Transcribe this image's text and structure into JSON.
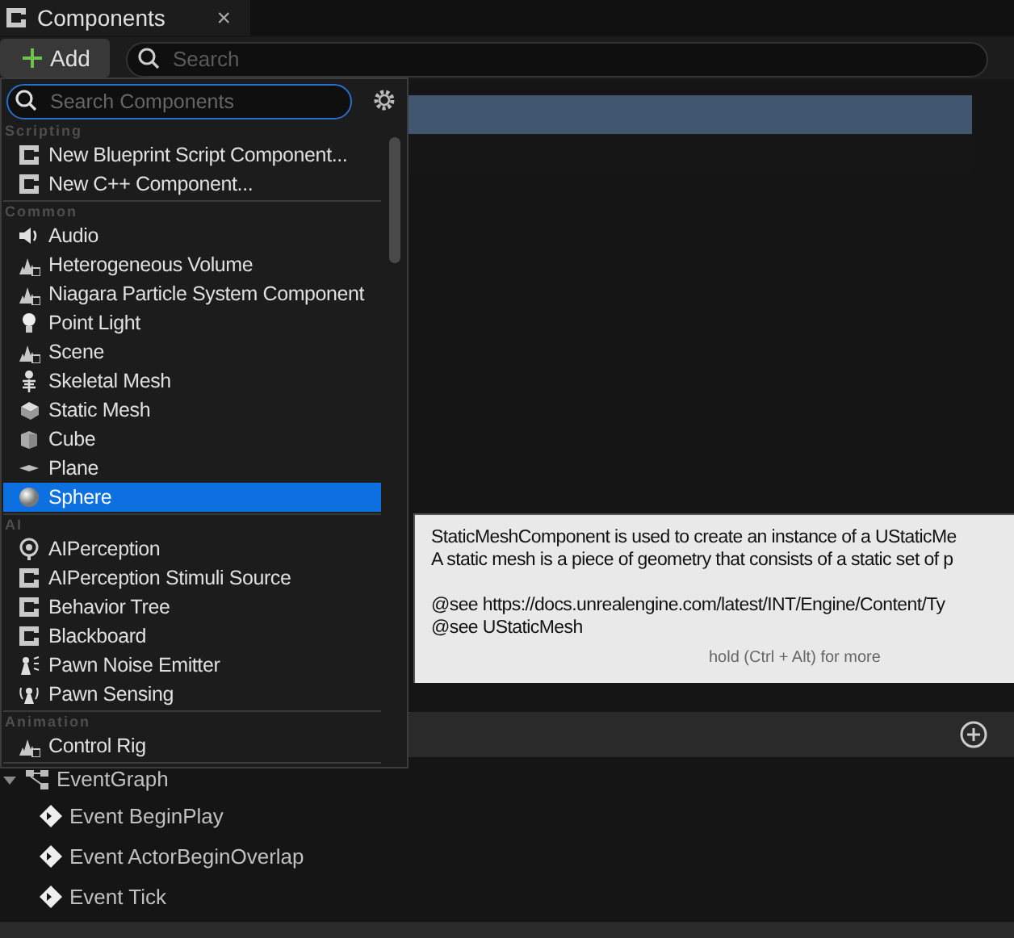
{
  "tab": {
    "title": "Components",
    "close": "×"
  },
  "toolbar": {
    "add_label": "Add",
    "search_placeholder": "Search"
  },
  "popup": {
    "search_placeholder": "Search Components",
    "sections": [
      {
        "title": "Scripting",
        "items": [
          {
            "label": "New Blueprint Script Component...",
            "kind": "class",
            "selected": false
          },
          {
            "label": "New C++ Component...",
            "kind": "class",
            "selected": false
          }
        ]
      },
      {
        "title": "Common",
        "items": [
          {
            "label": "Audio",
            "kind": "audio",
            "selected": false
          },
          {
            "label": "Heterogeneous Volume",
            "kind": "particles",
            "selected": false
          },
          {
            "label": "Niagara Particle System Component",
            "kind": "particles",
            "selected": false
          },
          {
            "label": "Point Light",
            "kind": "light",
            "selected": false
          },
          {
            "label": "Scene",
            "kind": "particles",
            "selected": false
          },
          {
            "label": "Skeletal Mesh",
            "kind": "skeleton",
            "selected": false
          },
          {
            "label": "Static Mesh",
            "kind": "mesh",
            "selected": false
          },
          {
            "label": "Cube",
            "kind": "cube",
            "selected": false
          },
          {
            "label": "Plane",
            "kind": "plane",
            "selected": false
          },
          {
            "label": "Sphere",
            "kind": "sphere",
            "selected": true
          }
        ]
      },
      {
        "title": "AI",
        "items": [
          {
            "label": "AIPerception",
            "kind": "perception",
            "selected": false
          },
          {
            "label": "AIPerception Stimuli Source",
            "kind": "class",
            "selected": false
          },
          {
            "label": "Behavior Tree",
            "kind": "class",
            "selected": false
          },
          {
            "label": "Blackboard",
            "kind": "class",
            "selected": false
          },
          {
            "label": "Pawn Noise Emitter",
            "kind": "pawn-noise",
            "selected": false
          },
          {
            "label": "Pawn Sensing",
            "kind": "pawn-sensing",
            "selected": false
          }
        ]
      },
      {
        "title": "Animation",
        "items": [
          {
            "label": "Control Rig",
            "kind": "particles",
            "selected": false
          }
        ]
      }
    ]
  },
  "tooltip": {
    "paragraphs": [
      [
        "StaticMeshComponent is used to create an instance of a UStaticMe",
        "A static mesh is a piece of geometry that consists of a static set of p"
      ],
      [
        "@see https://docs.unrealengine.com/latest/INT/Engine/Content/Ty",
        "@see UStaticMesh"
      ]
    ],
    "hint": "hold (Ctrl + Alt) for more"
  },
  "graph": {
    "title": "EventGraph",
    "expanded": true,
    "events": [
      "Event BeginPlay",
      "Event ActorBeginOverlap",
      "Event Tick"
    ]
  }
}
